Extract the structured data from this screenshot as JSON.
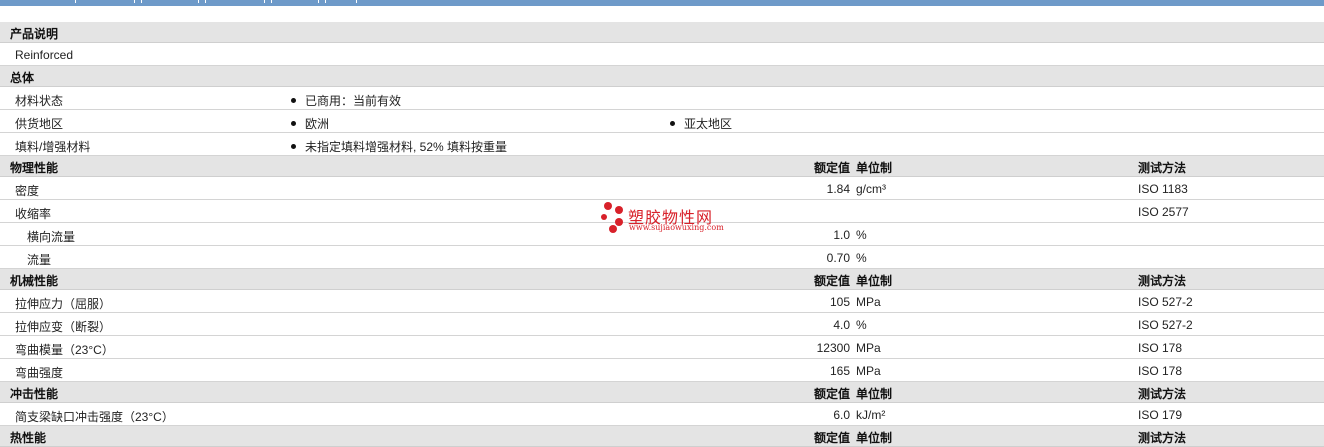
{
  "sections": {
    "desc": {
      "title": "产品说明",
      "text": "Reinforced"
    },
    "general": {
      "title": "总体",
      "status_label": "材料状态",
      "status_value": "已商用：当前有效",
      "supply_label": "供货地区",
      "supply_values": [
        "欧洲",
        "亚太地区"
      ],
      "filler_label": "填料/增强材料",
      "filler_value": "未指定填料增强材料, 52% 填料按重量"
    },
    "physical": {
      "title": "物理性能",
      "col_value": "额定值",
      "col_unit": "单位制",
      "col_test": "测试方法",
      "rows": [
        {
          "label": "密度",
          "value": "1.84",
          "unit": "g/cm³",
          "test": "ISO 1183"
        },
        {
          "label": "收缩率",
          "value": "",
          "unit": "",
          "test": "ISO 2577"
        },
        {
          "label": "横向流量",
          "value": "1.0",
          "unit": "%",
          "test": ""
        },
        {
          "label": "流量",
          "value": "0.70",
          "unit": "%",
          "test": ""
        }
      ]
    },
    "mechanical": {
      "title": "机械性能",
      "col_value": "额定值",
      "col_unit": "单位制",
      "col_test": "测试方法",
      "rows": [
        {
          "label": "拉伸应力（屈服）",
          "value": "105",
          "unit": "MPa",
          "test": "ISO 527-2"
        },
        {
          "label": "拉伸应变（断裂）",
          "value": "4.0",
          "unit": "%",
          "test": "ISO 527-2"
        },
        {
          "label": "弯曲模量（23°C）",
          "value": "12300",
          "unit": "MPa",
          "test": "ISO 178"
        },
        {
          "label": "弯曲强度",
          "value": "165",
          "unit": "MPa",
          "test": "ISO 178"
        }
      ]
    },
    "impact": {
      "title": "冲击性能",
      "col_value": "额定值",
      "col_unit": "单位制",
      "col_test": "测试方法",
      "rows": [
        {
          "label": "简支梁缺口冲击强度（23°C）",
          "value": "6.0",
          "unit": "kJ/m²",
          "test": "ISO 179"
        }
      ]
    },
    "thermal": {
      "title": "热性能",
      "col_value": "额定值",
      "col_unit": "单位制",
      "col_test": "测试方法"
    }
  },
  "watermark": {
    "name": "塑胶物性网",
    "url": "www.sujiaowuxing.com",
    "color": "#d8212a"
  },
  "colors": {
    "top_bar": "#6e9ac9",
    "section_bg": "#e4e4e4"
  }
}
